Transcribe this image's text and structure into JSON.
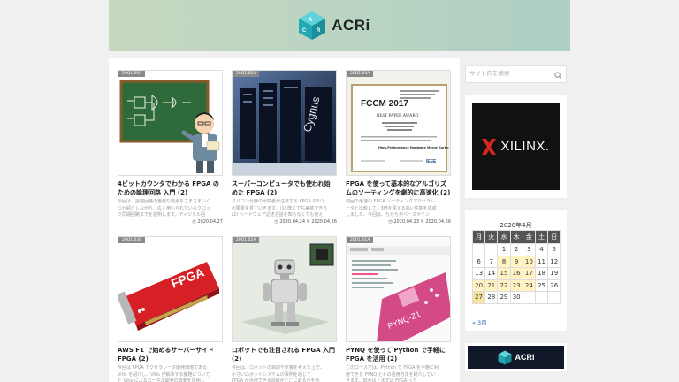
{
  "site": {
    "logo_text": "ACRi"
  },
  "posts": [
    {
      "badge": "20Q1.06A",
      "title": "4ビットカウンタでわかる FPGA の\nための論理回路 入門 (2)",
      "excerpt": "今回は、論理回路の重要な要素をさまざまいく\nつか紹介しながら、広く用いられているクロッ\nク同期回路までを説明します。ディジタル回",
      "date": "2020.04.27"
    },
    {
      "badge": "20Q1.05A",
      "title": "スーパーコンピュータでも使われ始\nめた FPGA (2)",
      "excerpt": "スパコン分野の研究者が注目する FPGA の3つ\nの要素を見ていきます。(1) 既にでも実装できる\n(2) ハードウェア記述言語を知らなくても使え",
      "date": "2020.04.24 ↻ 2020.04.26"
    },
    {
      "badge": "20Q1.04A",
      "title": "FPGA を使って基本的なアルゴリズ\nムのソーティングを劇的に高速化 (2)",
      "excerpt": "前回の最速の FPGA ソーティングアクセラレ\nータと比較して、3倍を超える高い性能を達成\nしました。今回は、ちからがベースライン",
      "date": "2020.04.23 ↻ 2020.04.26"
    },
    {
      "badge": "20Q1.03B",
      "title": "AWS F1 で始めるサーバーサイド\nFPGA (2)",
      "excerpt": "今回は FPGA アクセラレータ開発環境である\nVitis を紹介し、Vitis が解決する課題について\nと Vitis によるカーネル開発の概要を説明し",
      "date": ""
    },
    {
      "badge": "20Q1.02A",
      "title": "ロボットでも注目される FPGA 入門\n(2)",
      "excerpt": "今回は、ロボットの目的や定義を考えた上で、\n小さいロボットシステムの事例を通じて\nFPGA が活用できる領域がどこにあるかを見",
      "date": ""
    },
    {
      "badge": "20Q1.01A",
      "title": "PYNQ を使って Python で手軽に\nFPGA を活用 (2)",
      "excerpt": "このコースでは、Python で FPGA を手軽に利\n用できる PYNQ とその活用方法を紹介してい\nきます。前回は「まずは FPGA って",
      "date": ""
    }
  ],
  "sidebar": {
    "search_placeholder": "サイト内を検索",
    "xilinx_label": "XILINX.",
    "calendar": {
      "title": "2020年4月",
      "weekdays": [
        "月",
        "火",
        "水",
        "木",
        "金",
        "土",
        "日"
      ],
      "weeks": [
        [
          "",
          "",
          "1",
          "2",
          "3",
          "4",
          "5"
        ],
        [
          "6",
          "7",
          "8",
          "9",
          "10",
          "11",
          "12"
        ],
        [
          "13",
          "14",
          "15",
          "16",
          "17",
          "18",
          "19"
        ],
        [
          "20",
          "21",
          "22",
          "23",
          "24",
          "25",
          "26"
        ],
        [
          "27",
          "28",
          "29",
          "30",
          "",
          "",
          ""
        ]
      ],
      "prev_link": "« 3月"
    },
    "banner_text": "ACRi"
  },
  "colors": {
    "accent": "#3cbcc4",
    "header_start": "#c6d6bf",
    "header_end": "#aecfc4"
  }
}
